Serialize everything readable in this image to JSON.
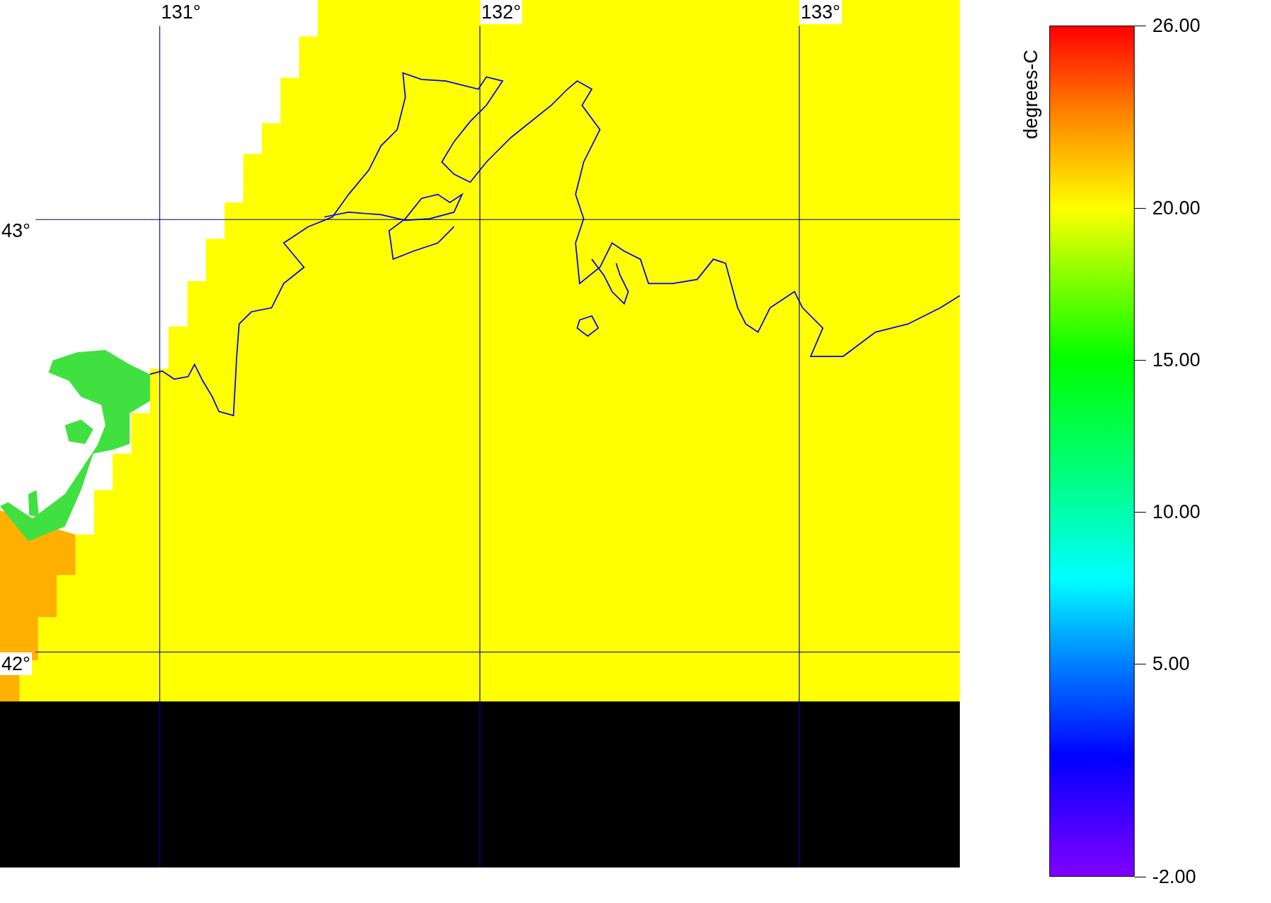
{
  "map": {
    "longitude_labels": [
      "131°",
      "132°",
      "133°"
    ],
    "latitude_labels": [
      "43°",
      "42°"
    ]
  },
  "colorbar": {
    "unit": "degrees-C",
    "ticks": [
      "26.00",
      "20.00",
      "15.00",
      "10.00",
      "5.00",
      "-2.00"
    ]
  }
}
